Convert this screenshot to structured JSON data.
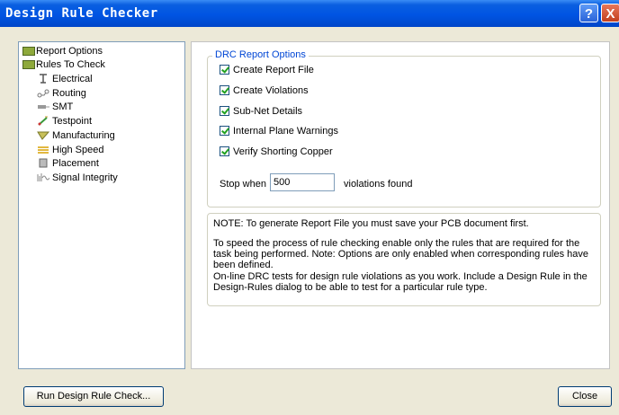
{
  "window": {
    "title": "Design Rule Checker"
  },
  "title_buttons": {
    "help": "?",
    "close": "X"
  },
  "tree": {
    "items": [
      {
        "label": "Report Options",
        "icon": "folder-icon"
      },
      {
        "label": "Rules To Check",
        "icon": "folder-icon"
      },
      {
        "label": "Electrical",
        "icon": "electrical-icon"
      },
      {
        "label": "Routing",
        "icon": "routing-icon"
      },
      {
        "label": "SMT",
        "icon": "smt-icon"
      },
      {
        "label": "Testpoint",
        "icon": "testpoint-icon"
      },
      {
        "label": "Manufacturing",
        "icon": "manufacturing-icon"
      },
      {
        "label": "High Speed",
        "icon": "high-speed-icon"
      },
      {
        "label": "Placement",
        "icon": "placement-icon"
      },
      {
        "label": "Signal Integrity",
        "icon": "signal-integrity-icon"
      }
    ]
  },
  "options": {
    "group_title": "DRC Report Options",
    "checkboxes": [
      {
        "label": "Create Report File",
        "checked": true
      },
      {
        "label": "Create Violations",
        "checked": true
      },
      {
        "label": "Sub-Net Details",
        "checked": true
      },
      {
        "label": "Internal Plane Warnings",
        "checked": true
      },
      {
        "label": "Verify Shorting Copper",
        "checked": true
      }
    ],
    "stop_label": "Stop when",
    "stop_value": "500",
    "stop_suffix": "violations found"
  },
  "note": {
    "line1": "NOTE: To generate Report File you must save your PCB document first.",
    "line2": "To speed the process of rule checking enable only the rules that are required for the task being performed.  Note: Options are only enabled when corresponding rules have been defined.",
    "line3": "On-line DRC tests for design rule violations as you work. Include a Design Rule in the Design-Rules dialog to be able to test for a particular rule  type."
  },
  "buttons": {
    "run": "Run Design Rule Check...",
    "close": "Close"
  }
}
